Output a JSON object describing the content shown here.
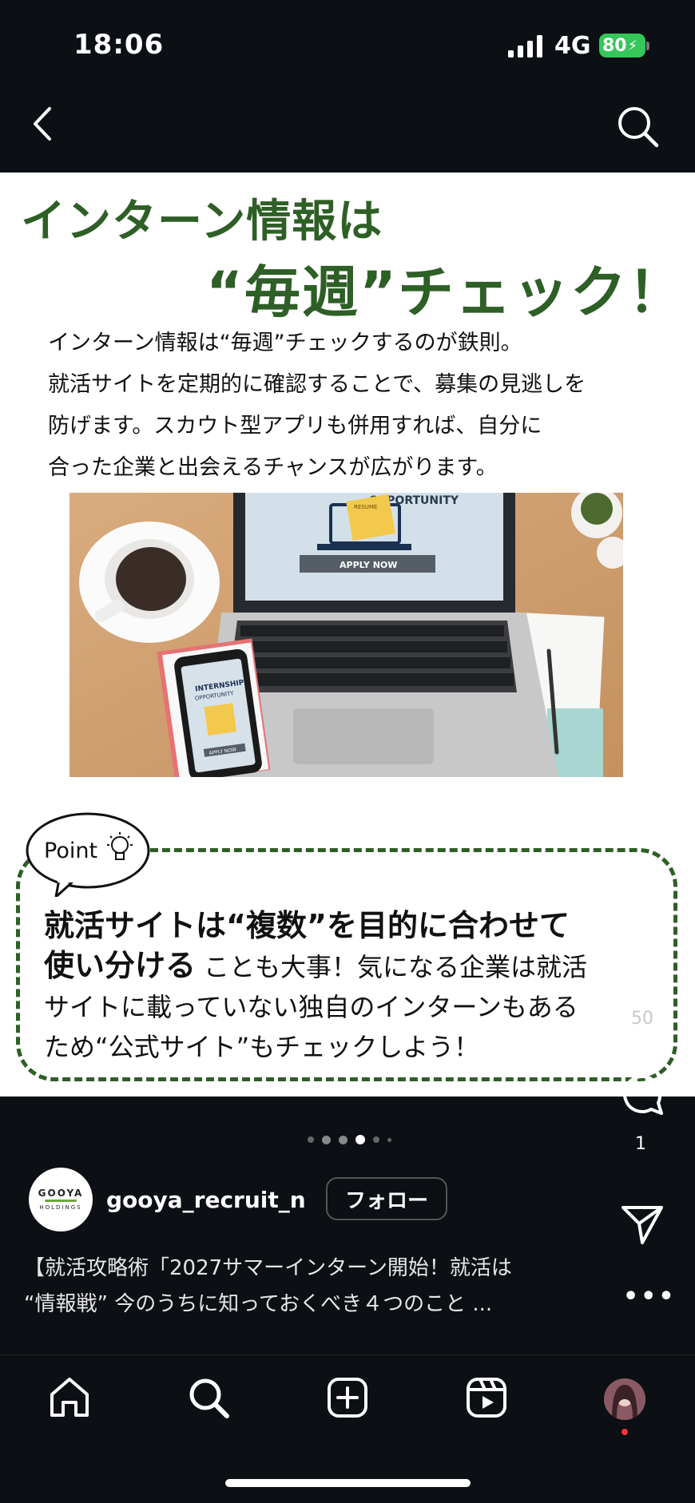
{
  "status_bar": {
    "time": "18:06",
    "network": "4G",
    "battery": "80"
  },
  "post": {
    "heading_line1": "インターン情報は",
    "heading_line2": "“毎週”チェック！",
    "body_lines": [
      "インターン情報は“毎週”チェックするのが鉄則。",
      "就活サイトを定期的に確認することで、募集の見逃しを",
      "防げます。スカウト型アプリも併用すれば、自分に",
      "合った企業と出会えるチャンスが広がります。"
    ],
    "photo": {
      "laptop_label": "OPPORTUNITY",
      "laptop_doc": "RESUME",
      "apply_button": "APPLY NOW",
      "phone_title": "INTERNSHIP",
      "phone_subtitle": "OPPORTUNITY",
      "phone_button": "APPLY NOW"
    },
    "point_label": "Point",
    "point_bold_line1": "就活サイトは“複数”を目的に合わせて",
    "point_bold_line2": "使い分ける",
    "point_rest_line2": "ことも大事！気になる企業は就活",
    "point_line3": "サイトに載っていない独自のインターンもある",
    "point_line4": "ため“公式サイト”もチェックしよう！"
  },
  "actions": {
    "likes": "50",
    "comments": "1"
  },
  "carousel": {
    "total": 6,
    "active_index": 3
  },
  "account": {
    "avatar_text": "GOOYA",
    "avatar_sub": "HOLDINGS",
    "username": "gooya_recruit_n",
    "follow_label": "フォロー"
  },
  "caption": {
    "line1": "【就活攻略術「2027サマーインターン開始！就活は",
    "line2": "“情報戦” 今のうちに知っておくべき４つのこと ..."
  },
  "colors": {
    "accent_green": "#2e5f26",
    "battery_green": "#34c759",
    "notification_red": "#ff3040"
  }
}
